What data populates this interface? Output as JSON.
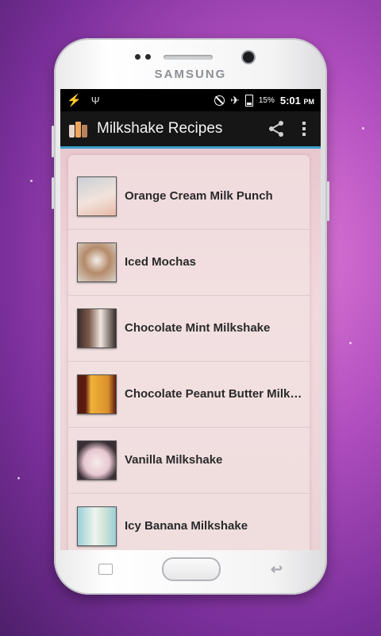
{
  "device": {
    "brand": "SAMSUNG"
  },
  "status_bar": {
    "battery_percent": "15%",
    "time": "5:01",
    "am_pm": "PM"
  },
  "action_bar": {
    "title": "Milkshake Recipes"
  },
  "recipes": [
    {
      "name": "Orange Cream Milk Punch",
      "thumb_colors": [
        "#c9cfd5",
        "#f2e3dc",
        "#e7b9a7"
      ]
    },
    {
      "name": "Iced Mochas",
      "thumb_colors": [
        "#d8d2c9",
        "#b58a6a",
        "#f3efe8"
      ]
    },
    {
      "name": "Chocolate Mint Milkshake",
      "thumb_colors": [
        "#3a2c2b",
        "#efe6df",
        "#7d5a4b"
      ]
    },
    {
      "name": "Chocolate Peanut Butter Milks…",
      "thumb_colors": [
        "#5a1a10",
        "#f1b23a",
        "#d98f2a"
      ]
    },
    {
      "name": "Vanilla Milkshake",
      "thumb_colors": [
        "#3a2e34",
        "#f6ece9",
        "#e7c7d2"
      ]
    },
    {
      "name": "Icy Banana Milkshake",
      "thumb_colors": [
        "#9acfd6",
        "#eef4ef",
        "#cfe3d8"
      ]
    }
  ]
}
